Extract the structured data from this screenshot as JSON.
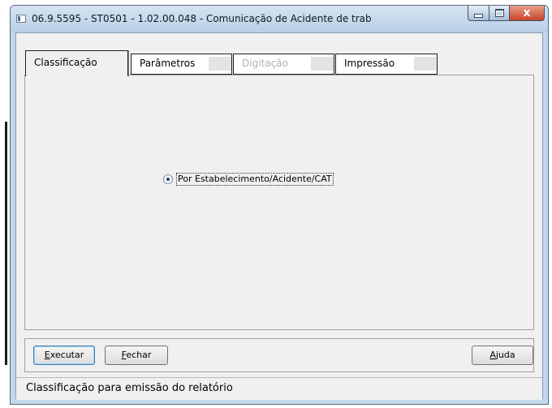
{
  "window": {
    "title": "06.9.5595 - ST0501 - 1.02.00.048 - Comunicação de Acidente de trab",
    "close_glyph": "x"
  },
  "tabs": [
    {
      "label": "Classificação",
      "state": "active"
    },
    {
      "label": "Parâmetros",
      "state": "normal"
    },
    {
      "label": "Digitação",
      "state": "disabled"
    },
    {
      "label": "Impressão",
      "state": "normal"
    }
  ],
  "classificacao": {
    "radio_label": "Por Estabelecimento/Acidente/CAT",
    "radio_selected": true
  },
  "buttons": {
    "executar": {
      "accel": "E",
      "rest": "xecutar"
    },
    "fechar": {
      "accel": "F",
      "rest": "echar"
    },
    "ajuda": {
      "accel": "A",
      "rest": "juda"
    }
  },
  "status_bar": {
    "text": "Classificação para emissão do relatório"
  },
  "colors": {
    "window_frame": "#c3d6ea",
    "close_button": "#c8432a",
    "radio_dot": "#1f3f74"
  }
}
